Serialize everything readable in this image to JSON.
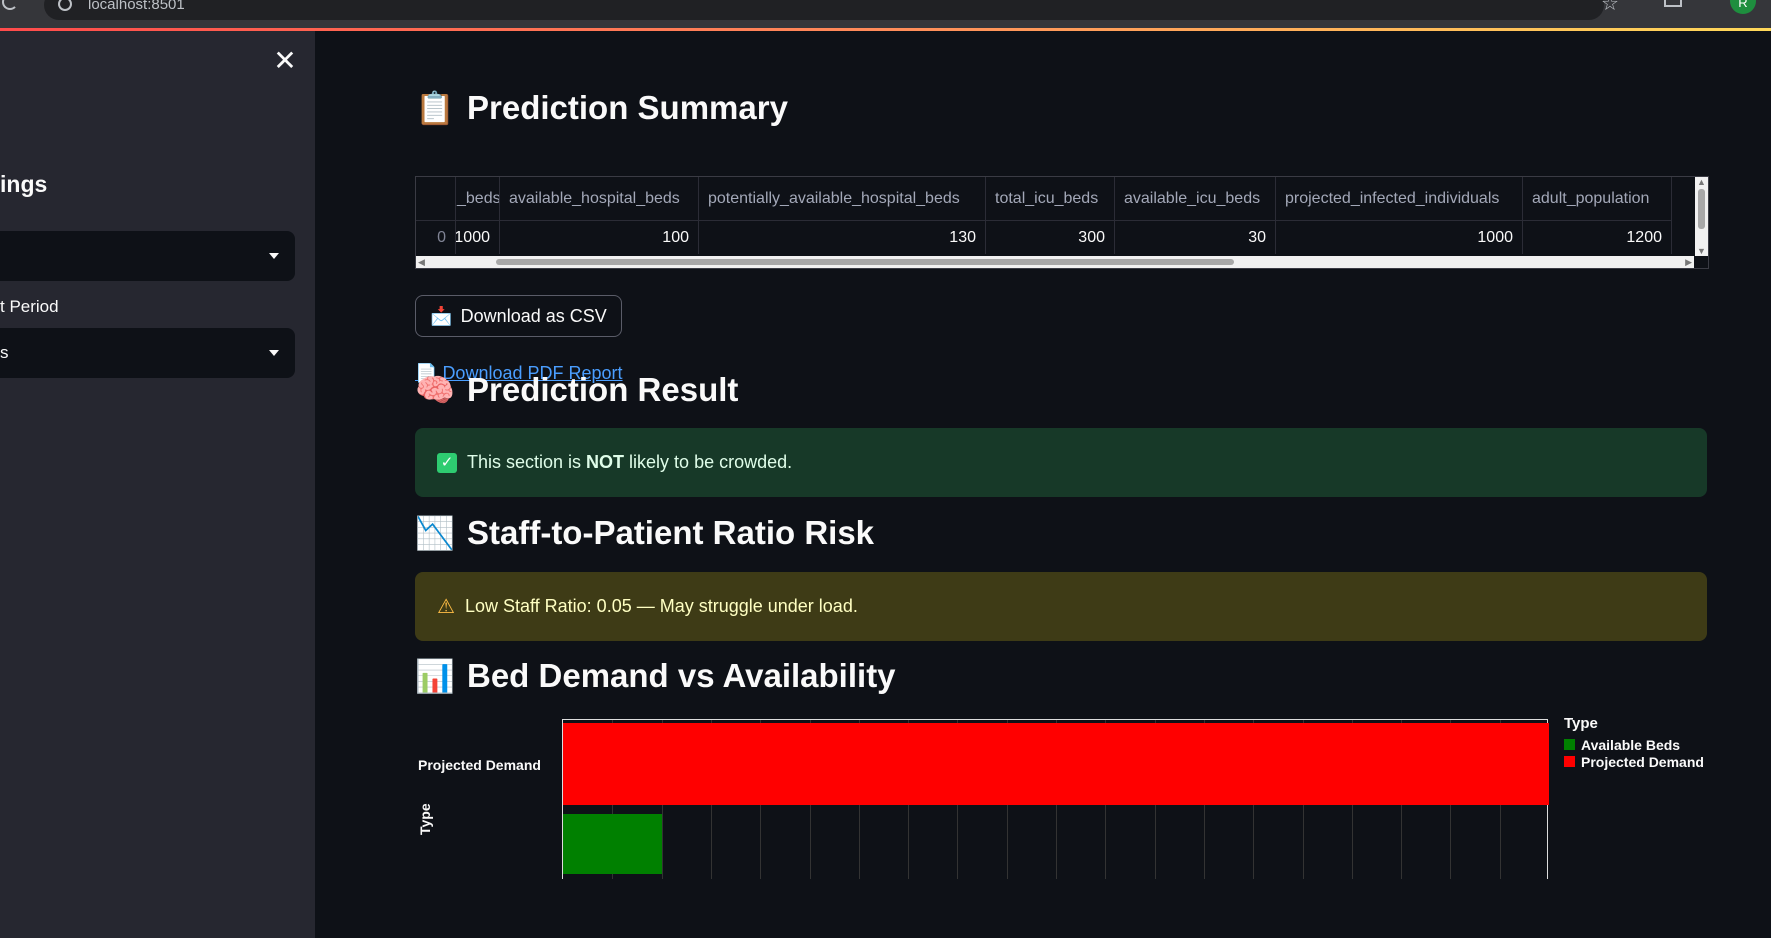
{
  "browser": {
    "url": "localhost:8501",
    "profile_initial": "R"
  },
  "sidebar": {
    "heading_fragment": "ings",
    "select1_value": "",
    "period_label_fragment": "t Period",
    "select2_value_fragment": "s"
  },
  "summary": {
    "title": "Prediction Summary",
    "emoji": "📋",
    "columns": [
      "",
      "_beds",
      "available_hospital_beds",
      "potentially_available_hospital_beds",
      "total_icu_beds",
      "available_icu_beds",
      "projected_infected_individuals",
      "adult_population"
    ],
    "row": [
      "0",
      "1000",
      "100",
      "130",
      "300",
      "30",
      "1000",
      "1200"
    ]
  },
  "download_csv": {
    "icon": "📩",
    "label": "Download as CSV"
  },
  "pdf_link": {
    "icon": "📄",
    "label": "Download PDF Report"
  },
  "result": {
    "title": "Prediction Result",
    "emoji": "🧠",
    "message_pre": "This section is ",
    "message_bold": "NOT",
    "message_post": " likely to be crowded."
  },
  "ratio": {
    "title": "Staff-to-Patient Ratio Risk",
    "emoji": "📉",
    "message": "Low Staff Ratio: 0.05 — May struggle under load."
  },
  "bed_chart": {
    "title": "Bed Demand vs Availability",
    "emoji": "📊",
    "colors": {
      "available": "#008000",
      "demand": "#ff0000"
    }
  },
  "chart_data": {
    "type": "bar",
    "orientation": "horizontal",
    "categories": [
      "Projected Demand",
      "Available Beds"
    ],
    "values": [
      1000,
      100
    ],
    "ylabel": "Type",
    "xlabel": "",
    "legend": {
      "title": "Type",
      "placement": "right",
      "entries": [
        "Available Beds",
        "Projected Demand"
      ]
    },
    "grid": true
  }
}
